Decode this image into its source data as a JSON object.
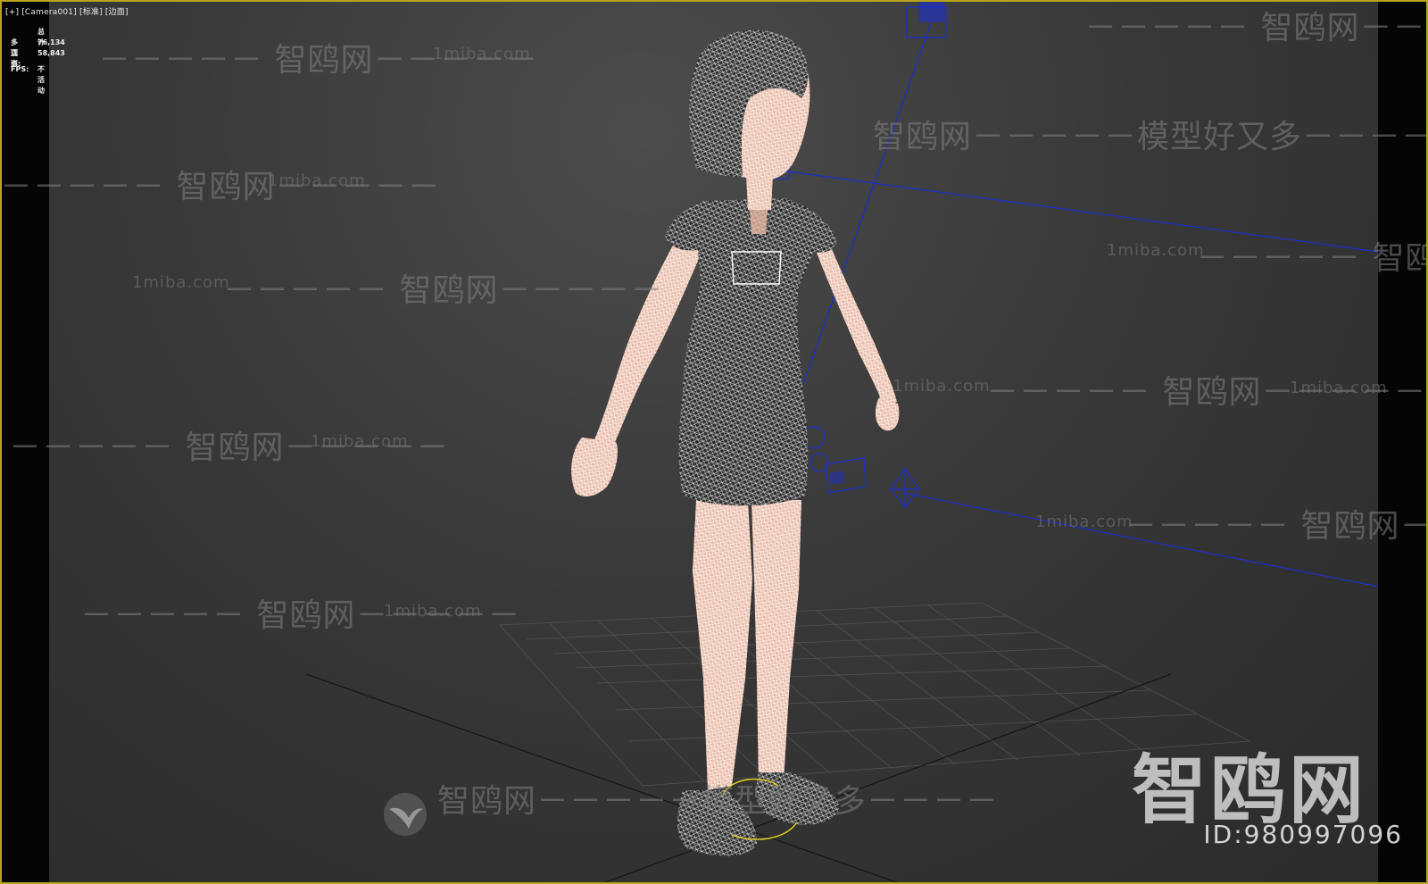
{
  "viewport": {
    "label": "[+] [Camera001] [标准] [边面]",
    "stats": {
      "header": "总计",
      "polys_label": "多边形:",
      "polys_value": "76,134",
      "verts_label": "顶点:",
      "verts_value": "58,843",
      "fps_label": "FPS:",
      "fps_value": "不活动"
    }
  },
  "watermarks": [
    "智鸥网－－－－－模型好又多－－－－",
    "－－－－－ 智鸥网－－－－－",
    "1miba.com",
    "1miba.com －－－－－ 智鸥网－－－－－",
    "智鸥网－－－－－模型好又多－－－－"
  ],
  "brand": {
    "name": "智鸥网",
    "id_text": "ID:980997096"
  },
  "colors": {
    "frame": "#b9a21c",
    "wire": "#ffffff",
    "skin": "#e9b9a4",
    "blue_helper": "#1c2fd0",
    "grid": "#555555"
  }
}
